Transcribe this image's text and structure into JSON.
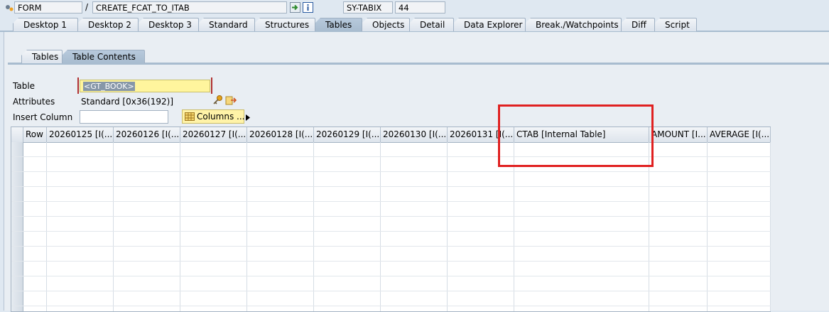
{
  "toolbar": {
    "context_type": "FORM",
    "separator": "/",
    "context_name": "CREATE_FCAT_TO_ITAB",
    "var_name": "SY-TABIX",
    "var_value": "44"
  },
  "main_tabs": [
    {
      "label": "Desktop 1"
    },
    {
      "label": "Desktop 2"
    },
    {
      "label": "Desktop 3"
    },
    {
      "label": "Standard"
    },
    {
      "label": "Structures"
    },
    {
      "label": "Tables"
    },
    {
      "label": "Objects"
    },
    {
      "label": "Detail"
    },
    {
      "label": "Data Explorer"
    },
    {
      "label": "Break./Watchpoints"
    },
    {
      "label": "Diff"
    },
    {
      "label": "Script"
    }
  ],
  "sub_tabs": [
    {
      "label": "Tables"
    },
    {
      "label": "Table Contents"
    }
  ],
  "form": {
    "table_label": "Table",
    "table_value": "<GT_BOOK>",
    "attributes_label": "Attributes",
    "attributes_value": "Standard [0x36(192)]",
    "insert_column_label": "Insert Column",
    "insert_column_value": "",
    "columns_button": "Columns ..."
  },
  "grid": {
    "columns": [
      "Row",
      "20260125 [I(...",
      "20260126 [I(...",
      "20260127 [I(...",
      "20260128 [I(...",
      "20260129 [I(...",
      "20260130 [I(...",
      "20260131 [I(...",
      "CTAB [Internal Table]",
      "AMOUNT [I...",
      "AVERAGE [I(..."
    ],
    "rows": []
  },
  "colors": {
    "highlight": "#e02020",
    "active_tab": "#a8bccf",
    "input_highlight": "#fff59d"
  }
}
